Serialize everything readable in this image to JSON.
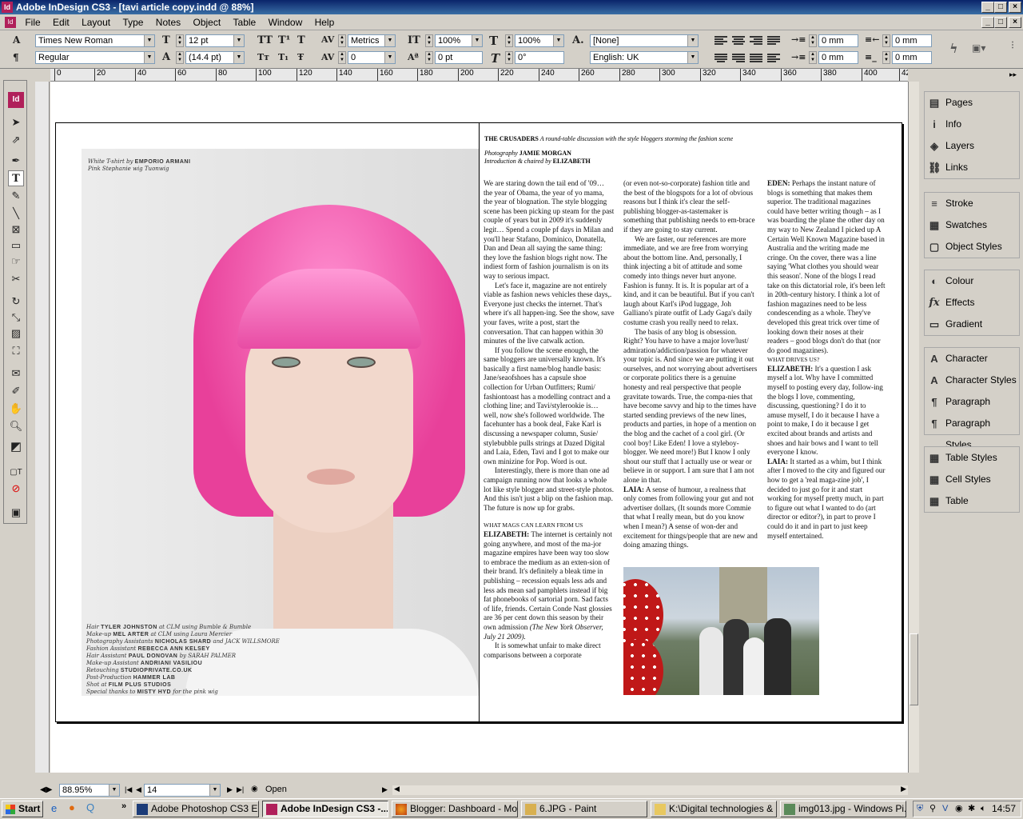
{
  "window": {
    "title": "Adobe InDesign CS3 - [tavi article copy.indd @ 88%]",
    "minimize": "_",
    "maximize": "□",
    "close": "×"
  },
  "menu": [
    "File",
    "Edit",
    "Layout",
    "Type",
    "Notes",
    "Object",
    "Table",
    "Window",
    "Help"
  ],
  "control": {
    "font_family": "Times New Roman",
    "font_style": "Regular",
    "font_size": "12 pt",
    "leading": "(14.4 pt)",
    "kerning": "Metrics",
    "tracking": "0",
    "vscale": "100%",
    "hscale": "100%",
    "baseline": "0 pt",
    "skew": "0°",
    "char_style": "[None]",
    "language": "English: UK",
    "indent_left": "0 mm",
    "indent_right": "0 mm",
    "indent_first": "0 mm",
    "indent_last": "0 mm"
  },
  "ruler_ticks": [
    "0",
    "20",
    "40",
    "60",
    "80",
    "100",
    "120",
    "140",
    "160",
    "180",
    "200",
    "220",
    "240",
    "260",
    "280",
    "300",
    "320",
    "340",
    "360",
    "380",
    "400",
    "42"
  ],
  "article": {
    "heading": "THE CRUSADERS",
    "heading_sub": "A round-table discussion with the style bloggers storming the fashion scene",
    "photo_label": "Photography",
    "photographer": "JAMIE MORGAN",
    "intro_label": "Introduction & chaired by",
    "chair": "ELIZABETH",
    "col1": [
      "We are staring down the tail end of '09… the year of Obama, the year of yo mama, the year of blognation. The style blogging scene has been picking up steam for the past couple of years but in 2009 it's suddenly legit… Spend a couple pf days in Milan and you'll hear Stafano, Dominico, Donatella, Dan and Dean all saying the same thing: they love the fashion blogs right now. The indiest form of fashion journalism is on its way to serious impact.",
      "Let's face it, magazine are not entirely viable as fashion news vehicles these days,. Everyone just checks the internet. That's where it's all happen-ing. See the show, save your faves, write a post, start the conversation. That can happen within 30 minutes of the live catwalk action.",
      "If you follow the scene enough, the same bloggers are universally known. It's basically a first name/blog handle basis: Jane/seaofshoes has a capsule shoe collection for Urban Outfitters; Rumi/ fashiontoast has a modelling contract and a clothing line; and Tavi/stylerookie is… well, now she's followed worldwide. The facehunter has a book deal, Fake Karl is discussing a newspaper column, Susie/ stylebubble pulls strings at Dazed Digital and Laia, Eden, Tavi and I got to make our own minizine for Pop. Word is out.",
      "Interestingly, there is more than one ad campaign running now that looks a whole lot like style blogger and street-style photos. And this isn't just a blip on the fashion map. The future is now up for grabs."
    ],
    "col1_sub": "WHAT MAGS CAN LEARN FROM US",
    "col1_b_name": "ELIZABETH:",
    "col1_b": "The internet is certainly not going anywhere, and most of the ma-jor magazine empires have been way too slow to embrace the medium as an exten-sion of their brand. It's definitely a bleak time in publishing – recession equals less ads and less ads mean sad pamphlets instead if big fat phonebooks of sartorial porn. Sad facts of life, friends. Certain Conde Nast glossies are 36 per cent down this season by their own admission",
    "col1_b_cite": "(The New York Observer, July 21 2009).",
    "col1_c": "It is somewhat unfair to make direct comparisons between a corporate",
    "col2": [
      "(or even not-so-corporate) fashion title and the best of the blogspots for a lot of obvious reasons but I think it's clear the self-publishing blogger-as-tastemaker is something that publishing needs to em-brace if they are going to stay current.",
      "We are faster, our references are more immediate, and we are free from worrying about the bottom line. And, personally, I think injecting a bit of attitude and some comedy into things never hurt anyone. Fashion is funny. It is. It is popular art of a kind, and it can be beautiful. But if you can't laugh about Karl's iPod luggage, Joh Galliano's pirate outfit of Lady Gaga's daily costume crash you really need to relax.",
      "The basis of any blog is obsession. Right? You have to have a major love/lust/ admiration/addiction/passion for whatever your topic is. And since we are putting it out ourselves, and not worrying about advertisers or corporate politics there is a genuine honesty and real perspective that people gravitate towards. True, the compa-nies that have become savvy and hip to the times have started sending previews of the new lines, products and parties, in hope of a mention on the blog and the cachet of a cool girl. (Or cool boy! Like Eden! I love a styleboy-blogger. We need more!) But I know I only shout our stuff that I actually use or wear or believe in or support. I am sure that I am not alone in that."
    ],
    "col2_b_name": "LAIA:",
    "col2_b": "A sense of humour, a realness that only comes from following your gut and not advertiser dollars, (It sounds more Commie that what I really mean, but do you know when I mean?) A sense of won-der and excitement for things/people that are new and doing amazing things.",
    "col3_a_name": "EDEN:",
    "col3_a": "Perhaps the instant nature of blogs is something that makes them superior. The traditional magazines could have better writing though – as I was boarding the plane the other day on my way to New Zealand I picked up A Certain Well Known Magazine based in Australia and the writing made me cringe. On the cover, there was a line saying 'What clothes you should wear this season'. None of the blogs I read take on this dictatorial role, it's been left in 20th-century history. I think a lot of fashion magazines need to be less condescending as a whole. They've developed this great trick over time of looking down their noses at their readers – good blogs don't do that (nor do good magazines).",
    "col3_sub": "WHAT DRIVES US?",
    "col3_b_name": "ELIZABETH:",
    "col3_b": "It's a question I ask myself a lot. Why have I committed myself to posting every day, follow-ing the blogs I love, commenting, discussing, questioning? I do it to amuse myself, I do it because I have a point to make, I do it because I get excited about brands and artists and shoes and hair bows and I want to tell everyone I know.",
    "col3_c_name": "LAIA:",
    "col3_c": "It started as a whim, but I think after I moved to the city and figured our how to get a 'real maga-zine job', I decided to just go for it and start working for myself pretty much, in part to figure out what I wanted to do (art director or editor?), in part to prove I could do it and in part to just keep myself entertained."
  },
  "photo_credits": {
    "top1_label": "White T-shirt by",
    "top1_name": "EMPORIO ARMANI",
    "top2": "Pink Stephanie wig Tuonwig",
    "lines": [
      {
        "label": "Hair",
        "name": "TYLER JOHNSTON",
        "rest": "at CLM using Bumble & Bumble"
      },
      {
        "label": "Make-up",
        "name": "MEL ARTER",
        "rest": "at CLM using Laura Mercier"
      },
      {
        "label": "Photography Assistants",
        "name": "NICHOLAS SHARD",
        "rest": "and JACK WILLSMORE"
      },
      {
        "label": "Fashion Assistant",
        "name": "REBECCA ANN KELSEY",
        "rest": ""
      },
      {
        "label": "Hair Assistant",
        "name": "PAUL DONOVAN",
        "rest": "by SARAH PALMER"
      },
      {
        "label": "Make-up Assistant",
        "name": "ANDRIANI VASILIOU",
        "rest": ""
      },
      {
        "label": "Retouching",
        "name": "STUDIOPRIVATE.CO.UK",
        "rest": ""
      },
      {
        "label": "Post-Production",
        "name": "HAMMER LAB",
        "rest": ""
      },
      {
        "label": "Shot at",
        "name": "FILM PLUS STUDIOS",
        "rest": ""
      },
      {
        "label": "Special thanks to",
        "name": "MISTY HYD",
        "rest": "for the pink wig"
      }
    ]
  },
  "status": {
    "zoom": "88.95%",
    "page": "14",
    "open": "Open"
  },
  "panels": [
    [
      "Pages",
      "Info",
      "Layers",
      "Links"
    ],
    [
      "Stroke",
      "Swatches",
      "Object Styles"
    ],
    [
      "Colour",
      "Effects",
      "Gradient"
    ],
    [
      "Character",
      "Character Styles",
      "Paragraph",
      "Paragraph Styles"
    ],
    [
      "Table Styles",
      "Cell Styles",
      "Table"
    ]
  ],
  "panel_icons": [
    [
      "▤",
      "i",
      "◈",
      "⛓"
    ],
    [
      "≡",
      "▦",
      "▢"
    ],
    [
      "◐",
      "fx",
      "▭"
    ],
    [
      "A",
      "A",
      "¶",
      "¶"
    ],
    [
      "▦",
      "▦",
      "▦"
    ]
  ],
  "taskbar": {
    "start": "Start",
    "tasks": [
      "Adobe Photoshop CS3 E...",
      "Adobe InDesign CS3 -...",
      "Blogger: Dashboard - Mo...",
      "6.JPG - Paint",
      "K:\\Digital technologies & ...",
      "img013.jpg - Windows Pi..."
    ],
    "time": "14:57"
  },
  "colors": {
    "accent": "#0a246a",
    "hair": "#e8409a",
    "app_icon": "#b0205a"
  }
}
